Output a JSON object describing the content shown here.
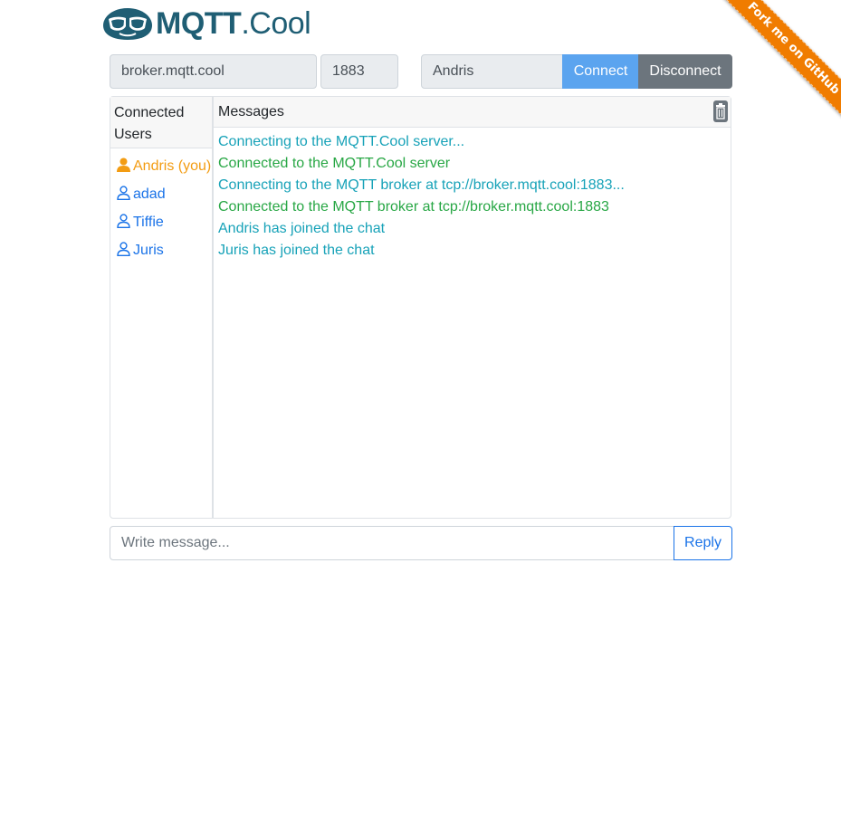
{
  "logo": {
    "brand_bold": "MQTT",
    "brand_rest": ".Cool"
  },
  "ribbon": {
    "label": "Fork me on GitHub"
  },
  "connection": {
    "host": "broker.mqtt.cool",
    "port": "1883",
    "username": "Andris",
    "connect_label": "Connect",
    "disconnect_label": "Disconnect"
  },
  "users_panel": {
    "title": "Connected Users",
    "users": [
      {
        "name": "Andris (you)",
        "self": true,
        "icon": "user-filled-icon"
      },
      {
        "name": "adad",
        "self": false,
        "icon": "user-outline-icon"
      },
      {
        "name": "Tiffie",
        "self": false,
        "icon": "user-outline-icon"
      },
      {
        "name": "Juris",
        "self": false,
        "icon": "user-outline-icon"
      }
    ]
  },
  "messages_panel": {
    "title": "Messages",
    "clear_icon": "trash-icon",
    "messages": [
      {
        "text": "Connecting to the MQTT.Cool server...",
        "kind": "info"
      },
      {
        "text": "Connected to the MQTT.Cool server",
        "kind": "ok"
      },
      {
        "text": "Connecting to the MQTT broker at tcp://broker.mqtt.cool:1883...",
        "kind": "info"
      },
      {
        "text": "Connected to the MQTT broker at tcp://broker.mqtt.cool:1883",
        "kind": "ok"
      },
      {
        "text": "Andris has joined the chat",
        "kind": "info"
      },
      {
        "text": "Juris has joined the chat",
        "kind": "info"
      }
    ]
  },
  "composer": {
    "placeholder": "Write message...",
    "value": "",
    "reply_label": "Reply"
  },
  "colors": {
    "brand": "#1f5e74",
    "connect": "#5ba4ef",
    "disconnect": "#6c757d",
    "self_user": "#f39c12",
    "user": "#1a73e8",
    "info_message": "#17a2b8",
    "ok_message": "#28a745",
    "ribbon": "#f07c00"
  }
}
